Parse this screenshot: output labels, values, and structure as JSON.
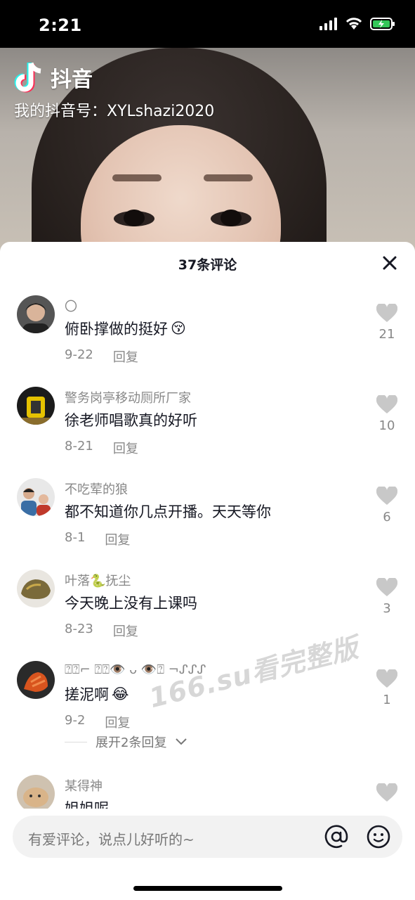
{
  "status_bar": {
    "time": "2:21"
  },
  "video": {
    "app_name": "抖音",
    "douyin_id": "我的抖音号：XYLshazi2020"
  },
  "comments_panel": {
    "title": "37条评论",
    "reply_label": "回复",
    "comments": [
      {
        "user": "〇",
        "text": "俯卧撑做的挺好",
        "emoji": "😚",
        "date": "9-22",
        "likes": "21"
      },
      {
        "user": "警务岗亭移动厕所厂家",
        "text": "徐老师唱歌真的好听",
        "emoji": "",
        "date": "8-21",
        "likes": "10"
      },
      {
        "user": "不吃荤的狼",
        "text": "都不知道你几点开播。天天等你",
        "emoji": "",
        "date": "8-1",
        "likes": "6"
      },
      {
        "user": "叶落🐍抚尘",
        "text": "今天晚上没有上课吗",
        "emoji": "",
        "date": "8-23",
        "likes": "3"
      },
      {
        "user": "⍰⍰⌐ ⍰⍰👁️ ᴗ 👁️⍰ ¬ᔑᔑᔑ",
        "text": "搓泥啊",
        "emoji": "😂",
        "date": "9-2",
        "likes": "1"
      },
      {
        "user": "某得神",
        "text": "姐姐呢",
        "emoji": "",
        "date": "",
        "likes": ""
      }
    ],
    "expand_replies": "展开2条回复",
    "watermark": "166.su看完整版"
  },
  "input_bar": {
    "placeholder": "有爱评论，说点儿好听的~"
  },
  "colors": {
    "brand_text": "#161823",
    "secondary_text": "#888888",
    "input_bg": "#f2f2f2"
  }
}
